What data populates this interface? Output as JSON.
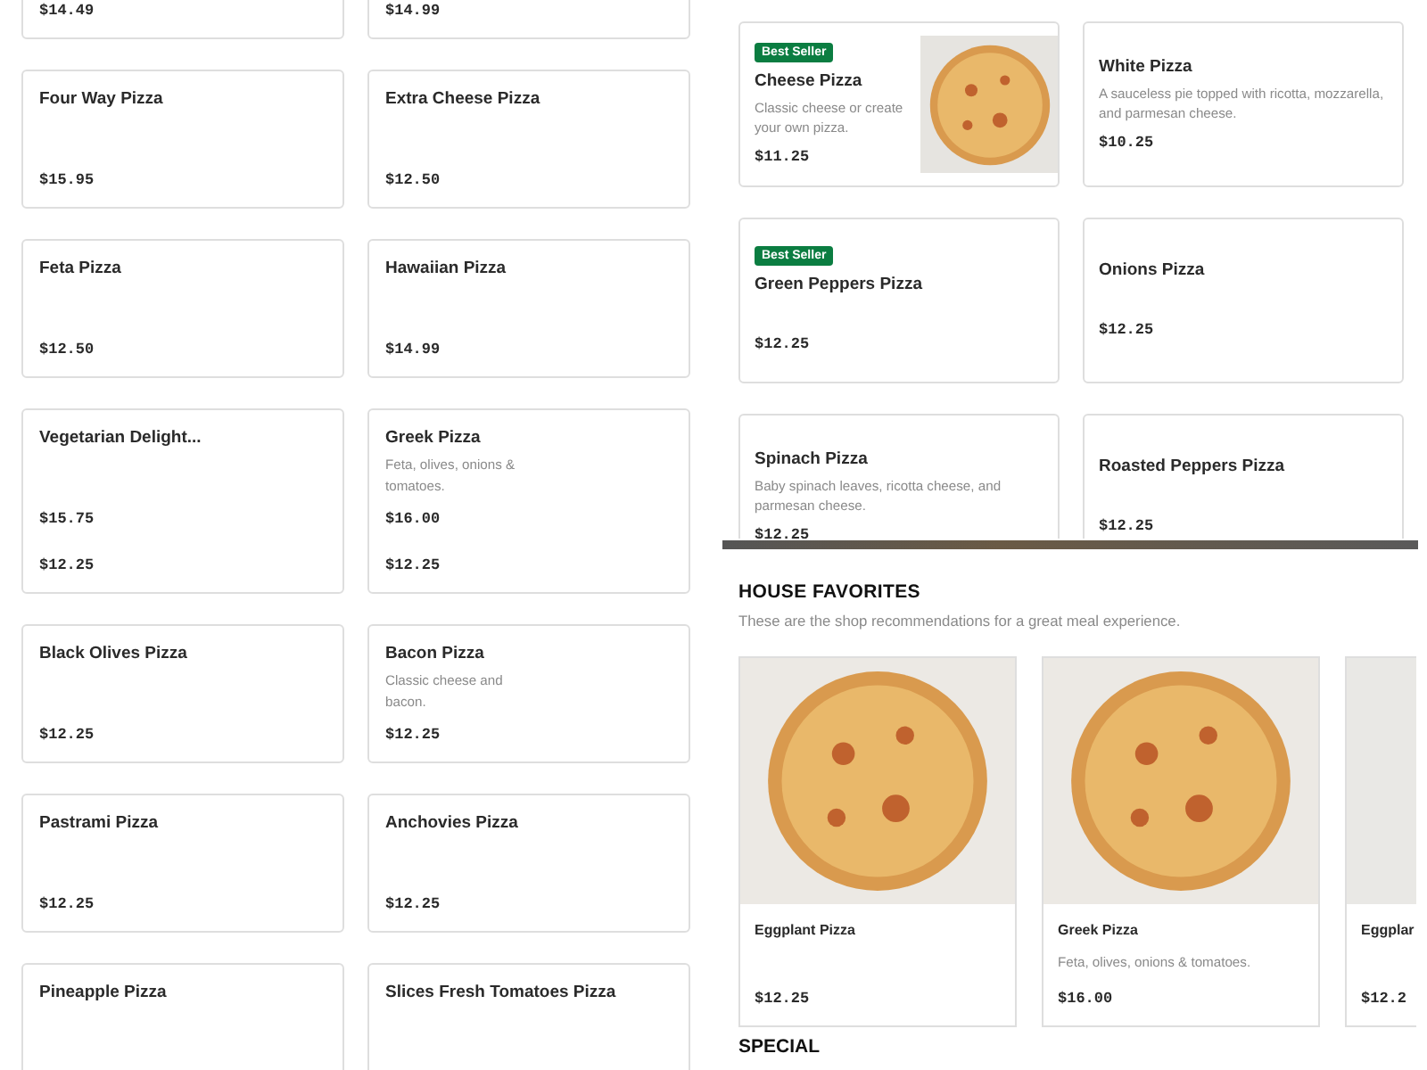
{
  "left_upper": {
    "cards": [
      {
        "price": "$14.49"
      },
      {
        "price": "$14.99"
      },
      {
        "name": "Four Way Pizza",
        "price": "$15.95"
      },
      {
        "name": "Extra Cheese Pizza",
        "price": "$12.50"
      },
      {
        "name": "Feta Pizza",
        "price": "$12.50"
      },
      {
        "name": "Hawaiian Pizza",
        "price": "$14.99"
      },
      {
        "name": "Vegetarian Delight...",
        "price": "$15.75"
      },
      {
        "name": "Greek Pizza",
        "description": "Feta, olives, onions & tomatoes.",
        "price": "$16.00"
      }
    ]
  },
  "left_lower": {
    "cards": [
      {
        "price": "$12.25"
      },
      {
        "price": "$12.25"
      },
      {
        "name": "Black Olives Pizza",
        "price": "$12.25"
      },
      {
        "name": "Bacon Pizza",
        "description": "Classic cheese and bacon.",
        "price": "$12.25"
      },
      {
        "name": "Pastrami Pizza",
        "price": "$12.25"
      },
      {
        "name": "Anchovies Pizza",
        "price": "$12.25"
      },
      {
        "name": "Pineapple Pizza"
      },
      {
        "name": "Slices Fresh Tomatoes Pizza"
      }
    ]
  },
  "right_upper": {
    "cards": [
      {
        "badge": "Best Seller",
        "name": "Cheese Pizza",
        "description": "Classic cheese or create your own pizza.",
        "price": "$11.25",
        "kind": "with-photo"
      },
      {
        "name": "White Pizza",
        "description": "A sauceless pie topped with ricotta, mozzarella, and parmesan cheese.",
        "price": "$10.25"
      },
      {
        "badge": "Best Seller",
        "name": "Green Peppers Pizza",
        "price": "$12.25"
      },
      {
        "name": "Onions Pizza",
        "price": "$12.25"
      },
      {
        "name": "Spinach Pizza",
        "description": "Baby spinach leaves, ricotta cheese, and parmesan cheese.",
        "price": "$12.25"
      },
      {
        "name": "Roasted Peppers Pizza",
        "price": "$12.25"
      }
    ]
  },
  "house_favorites": {
    "title": "HOUSE FAVORITES",
    "subtitle": "These are the shop recommendations for a great meal experience.",
    "items": [
      {
        "kind": "pizza-photo",
        "name": "Eggplant Pizza",
        "price": "$12.25"
      },
      {
        "kind": "pizza-photo",
        "name": "Greek Pizza",
        "description": "Feta, olives, onions & tomatoes.",
        "price": "$16.00"
      },
      {
        "kind": "blank-photo",
        "name": "Eggplar",
        "price": "$12.2"
      }
    ]
  },
  "next_section": {
    "title": "SPECIAL"
  }
}
